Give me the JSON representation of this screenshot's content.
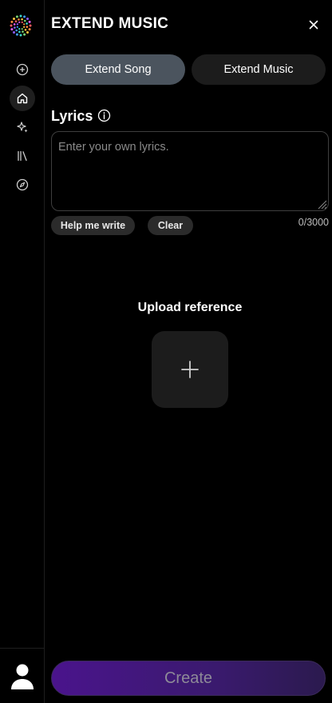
{
  "header": {
    "title": "EXTEND MUSIC",
    "close_icon": "close-icon"
  },
  "sidebar": {
    "logo_icon": "app-logo-icon",
    "items": [
      {
        "icon": "plus-circle-icon",
        "active": false
      },
      {
        "icon": "home-icon",
        "active": true
      },
      {
        "icon": "sparkle-icon",
        "active": false
      },
      {
        "icon": "library-icon",
        "active": false
      },
      {
        "icon": "compass-icon",
        "active": false
      }
    ],
    "avatar_icon": "user-avatar-icon"
  },
  "tabs": [
    {
      "label": "Extend Song",
      "selected": true
    },
    {
      "label": "Extend Music",
      "selected": false
    }
  ],
  "lyrics": {
    "label": "Lyrics",
    "placeholder": "Enter your own lyrics.",
    "value": "",
    "counter": "0/3000",
    "help_label": "Help me write",
    "clear_label": "Clear"
  },
  "upload": {
    "label": "Upload reference"
  },
  "create": {
    "label": "Create"
  },
  "colors": {
    "background": "#000000",
    "tab_selected": "#4b545e",
    "tab_unselected": "#1c1c1c",
    "create_gradient_start": "#4a148c"
  }
}
